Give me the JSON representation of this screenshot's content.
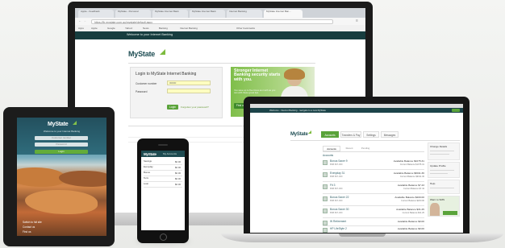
{
  "imac": {
    "tabs": [
      "Apple - Feedback",
      "MyState - Personal",
      "MyState Internet Bank",
      "MyState Internet Bank",
      "Internet Banking",
      "MyState Internet Ban..."
    ],
    "url": "https://ib.mystate.com.au/mystate/default.aspx",
    "bookmarks": [
      "Apps",
      "Apple",
      "Google",
      "Yahoo!",
      "News",
      "Banking",
      "Internet Banking",
      "Other bookmarks"
    ],
    "topbar_text": "Welcome to your Internet Banking",
    "logo": "MyState",
    "login": {
      "title": "Login to MyState Internet Banking",
      "customer_number_label": "Customer number",
      "customer_number_value": "00000",
      "password_label": "Password",
      "login_button": "Login",
      "forgot_link": "Forgotten your password?"
    },
    "promo": {
      "headline": "Stronger Internet Banking security starts with you.",
      "subtext": "You save up to five times as much as you can with these great tips.",
      "button": "Find out more"
    }
  },
  "ipad": {
    "logo": "MyState",
    "tagline": "Welcome to your Internet Banking",
    "customer_placeholder": "Customer number",
    "password_placeholder": "Password",
    "login_button": "Login",
    "footer_links": [
      "Switch to full site",
      "Contact us",
      "Find us"
    ]
  },
  "iphone": {
    "logo": "MyState",
    "header": "My Accounts",
    "rows": [
      {
        "name": "Savings",
        "value": "$0.00"
      },
      {
        "name": "Everyday",
        "value": "$0.00"
      },
      {
        "name": "Bonus",
        "value": "$0.00"
      },
      {
        "name": "Term",
        "value": "$0.00"
      },
      {
        "name": "Loan",
        "value": "$0.00"
      }
    ]
  },
  "macbook": {
    "notice": "Welcome - Internet Banking - navigate to a new MyState",
    "logo": "MyState",
    "nav_tabs": [
      "Accounts",
      "Transfers & Pay",
      "Settings",
      "Messages"
    ],
    "subtabs": [
      "Accounts",
      "Recent",
      "Pending"
    ],
    "section_title": "Accounts",
    "accounts": [
      {
        "name": "Bonus Saver 9",
        "sub": "BSB 807-009",
        "bal": "Available Balance $1075.31",
        "bal2": "Current Balance $1075.31"
      },
      {
        "name": "Everyday 31",
        "sub": "BSB 807-009",
        "bal": "Available Balance $9011.36",
        "bal2": "Current Balance $9011.36"
      },
      {
        "name": "Fit 3",
        "sub": "BSB 807-009",
        "bal": "Available Balance $7.43",
        "bal2": "Current Balance $7.43"
      },
      {
        "name": "Bonus Saver 22",
        "sub": "BSB 807-009",
        "bal": "Available Balance $200.00",
        "bal2": "Current Balance $200.00"
      },
      {
        "name": "Bonus Saver 30",
        "sub": "BSB 807-009",
        "bal": "Available Balance $31.25",
        "bal2": "Current Balance $31.25"
      },
      {
        "name": "W Retirement",
        "sub": "BSB 807-009",
        "bal": "Available Balance $0.00",
        "bal2": "Current Balance $0.00"
      },
      {
        "name": "HP LifeStyle 2",
        "sub": "BSB 807-009",
        "bal": "Available Balance $0.00",
        "bal2": "Current Balance $0.00"
      }
    ],
    "side_cards": [
      "Change Details",
      "Update Profile",
      "Help",
      "Want to SMS"
    ]
  }
}
